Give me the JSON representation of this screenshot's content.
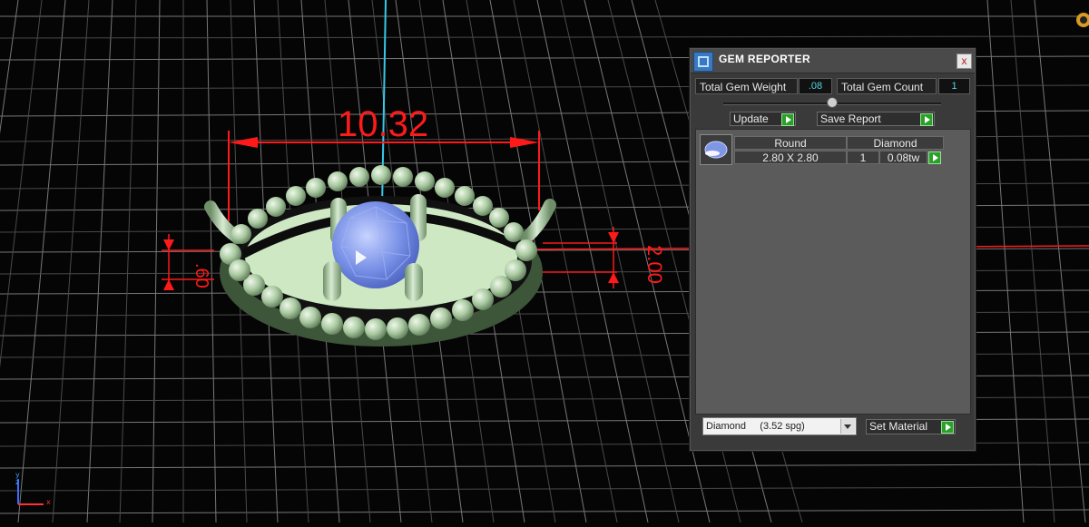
{
  "viewport": {
    "dimension_width": "10.32",
    "dimension_left_height": ".60",
    "dimension_right_height": "2.00",
    "axis": {
      "y": "y",
      "z": "z",
      "x": "x"
    }
  },
  "panel": {
    "title": "GEM REPORTER",
    "close_label": "x",
    "total_weight_label": "Total Gem Weight",
    "total_weight_value": ".08",
    "total_count_label": "Total Gem Count",
    "total_count_value": "1",
    "update_label": "Update",
    "save_report_label": "Save Report",
    "table": {
      "headers": [
        "Round",
        "Diamond"
      ],
      "row": {
        "size": "2.80 X 2.80",
        "count": "1",
        "weight": "0.08tw"
      }
    },
    "material_select": "Diamond     (3.52 spg)",
    "set_material_label": "Set Material"
  },
  "colors": {
    "dimension": "#ff1a1a",
    "metal": "#b8d8b0",
    "gem": "#6f8ee8",
    "grid": "#9a9a9a",
    "cyan_axis": "#38c8e8",
    "go_button": "#2aa02a"
  }
}
